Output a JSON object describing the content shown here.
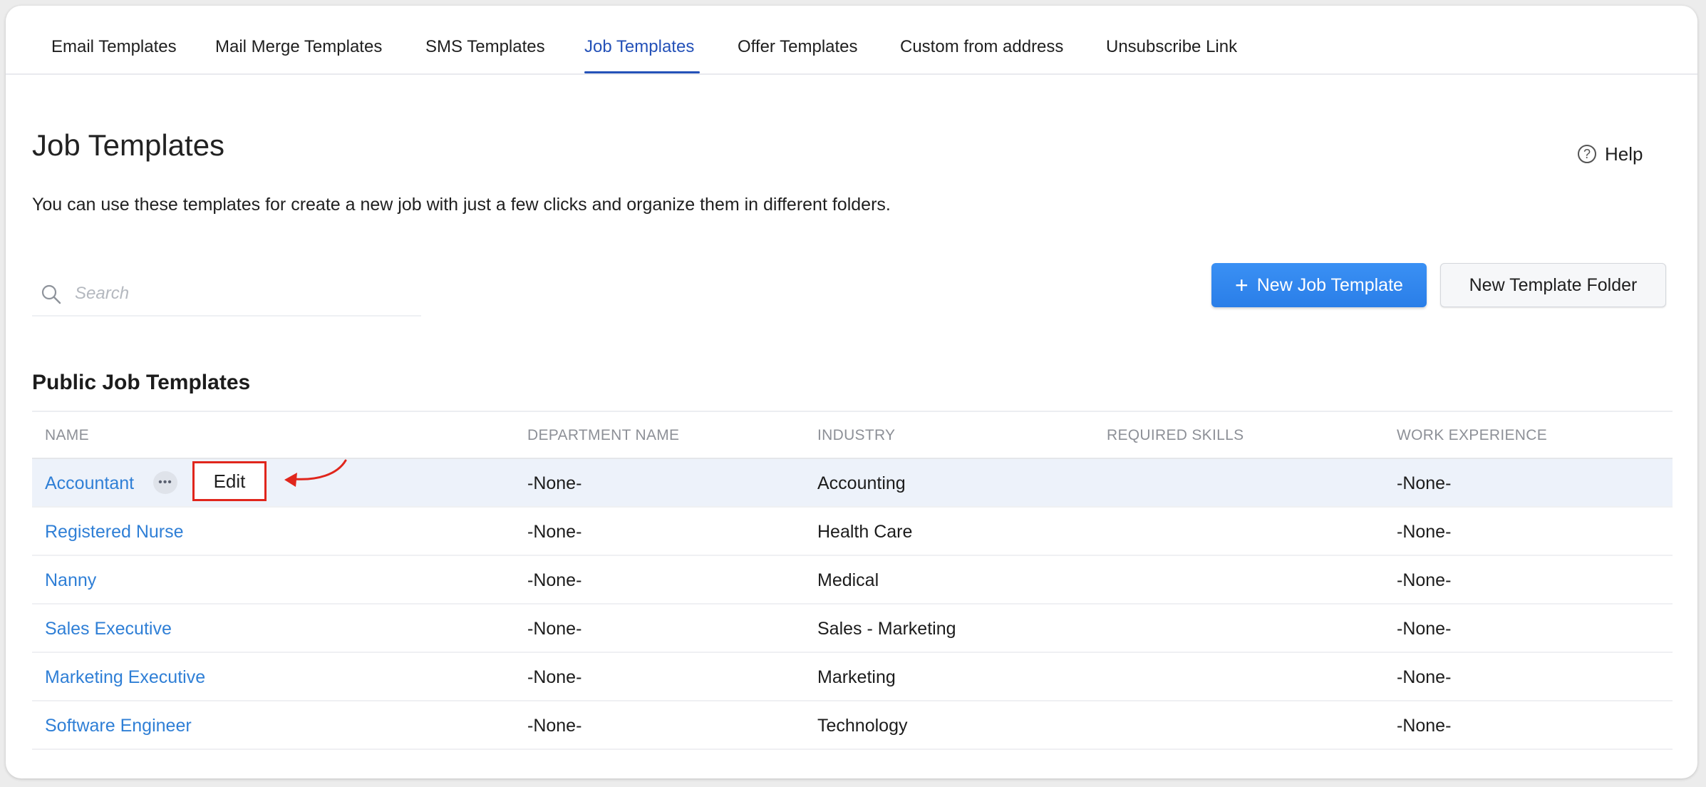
{
  "tabs": [
    {
      "label": "Email Templates"
    },
    {
      "label": "Mail Merge Templates"
    },
    {
      "label": "SMS Templates"
    },
    {
      "label": "Job Templates",
      "active": true
    },
    {
      "label": "Offer Templates"
    },
    {
      "label": "Custom from address"
    },
    {
      "label": "Unsubscribe Link"
    }
  ],
  "page": {
    "title": "Job Templates",
    "description": "You can use these templates for create a new job with just a few clicks and organize them in different folders.",
    "help_label": "Help",
    "help_icon": "question-circle-icon"
  },
  "search": {
    "placeholder": "Search",
    "value": ""
  },
  "actions": {
    "new_job_template": "New Job Template",
    "new_template_folder": "New Template Folder"
  },
  "section": {
    "title": "Public Job Templates"
  },
  "table": {
    "headers": {
      "name": "NAME",
      "department": "DEPARTMENT NAME",
      "industry": "INDUSTRY",
      "skills": "REQUIRED SKILLS",
      "experience": "WORK EXPERIENCE"
    },
    "rows": [
      {
        "name": "Accountant",
        "department": "-None-",
        "industry": "Accounting",
        "skills": "",
        "experience": "-None-"
      },
      {
        "name": "Registered Nurse",
        "department": "-None-",
        "industry": "Health Care",
        "skills": "",
        "experience": "-None-"
      },
      {
        "name": "Nanny",
        "department": "-None-",
        "industry": "Medical",
        "skills": "",
        "experience": "-None-"
      },
      {
        "name": "Sales Executive",
        "department": "-None-",
        "industry": "Sales - Marketing",
        "skills": "",
        "experience": "-None-"
      },
      {
        "name": "Marketing Executive",
        "department": "-None-",
        "industry": "Marketing",
        "skills": "",
        "experience": "-None-"
      },
      {
        "name": "Software Engineer",
        "department": "-None-",
        "industry": "Technology",
        "skills": "",
        "experience": "-None-"
      }
    ]
  },
  "row_menu": {
    "edit_label": "Edit"
  },
  "colors": {
    "accent": "#2451b8",
    "link": "#2f7fd6",
    "primary_button": "#2a7ee8",
    "highlight_row": "#edf2fa",
    "annotation_red": "#e0261c"
  }
}
